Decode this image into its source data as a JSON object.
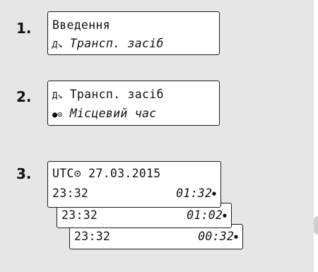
{
  "steps": [
    {
      "number": "1.",
      "line1": "Введення",
      "line2_icon": "Д↘",
      "line2_text": "Трансп. засіб"
    },
    {
      "number": "2.",
      "line1_icon": "Д↘",
      "line1_text": "Трансп. засіб",
      "line2_icon": "●⊙",
      "line2_text": "Місцевий час"
    },
    {
      "number": "3.",
      "header": "UTC⊙ 27.03.2015",
      "rows": [
        {
          "utc": "23:32",
          "local": "01:32",
          "mark": "●"
        },
        {
          "utc": "23:32",
          "local": "01:02",
          "mark": "●"
        },
        {
          "utc": "23:32",
          "local": "00:32",
          "mark": "●"
        }
      ]
    }
  ]
}
